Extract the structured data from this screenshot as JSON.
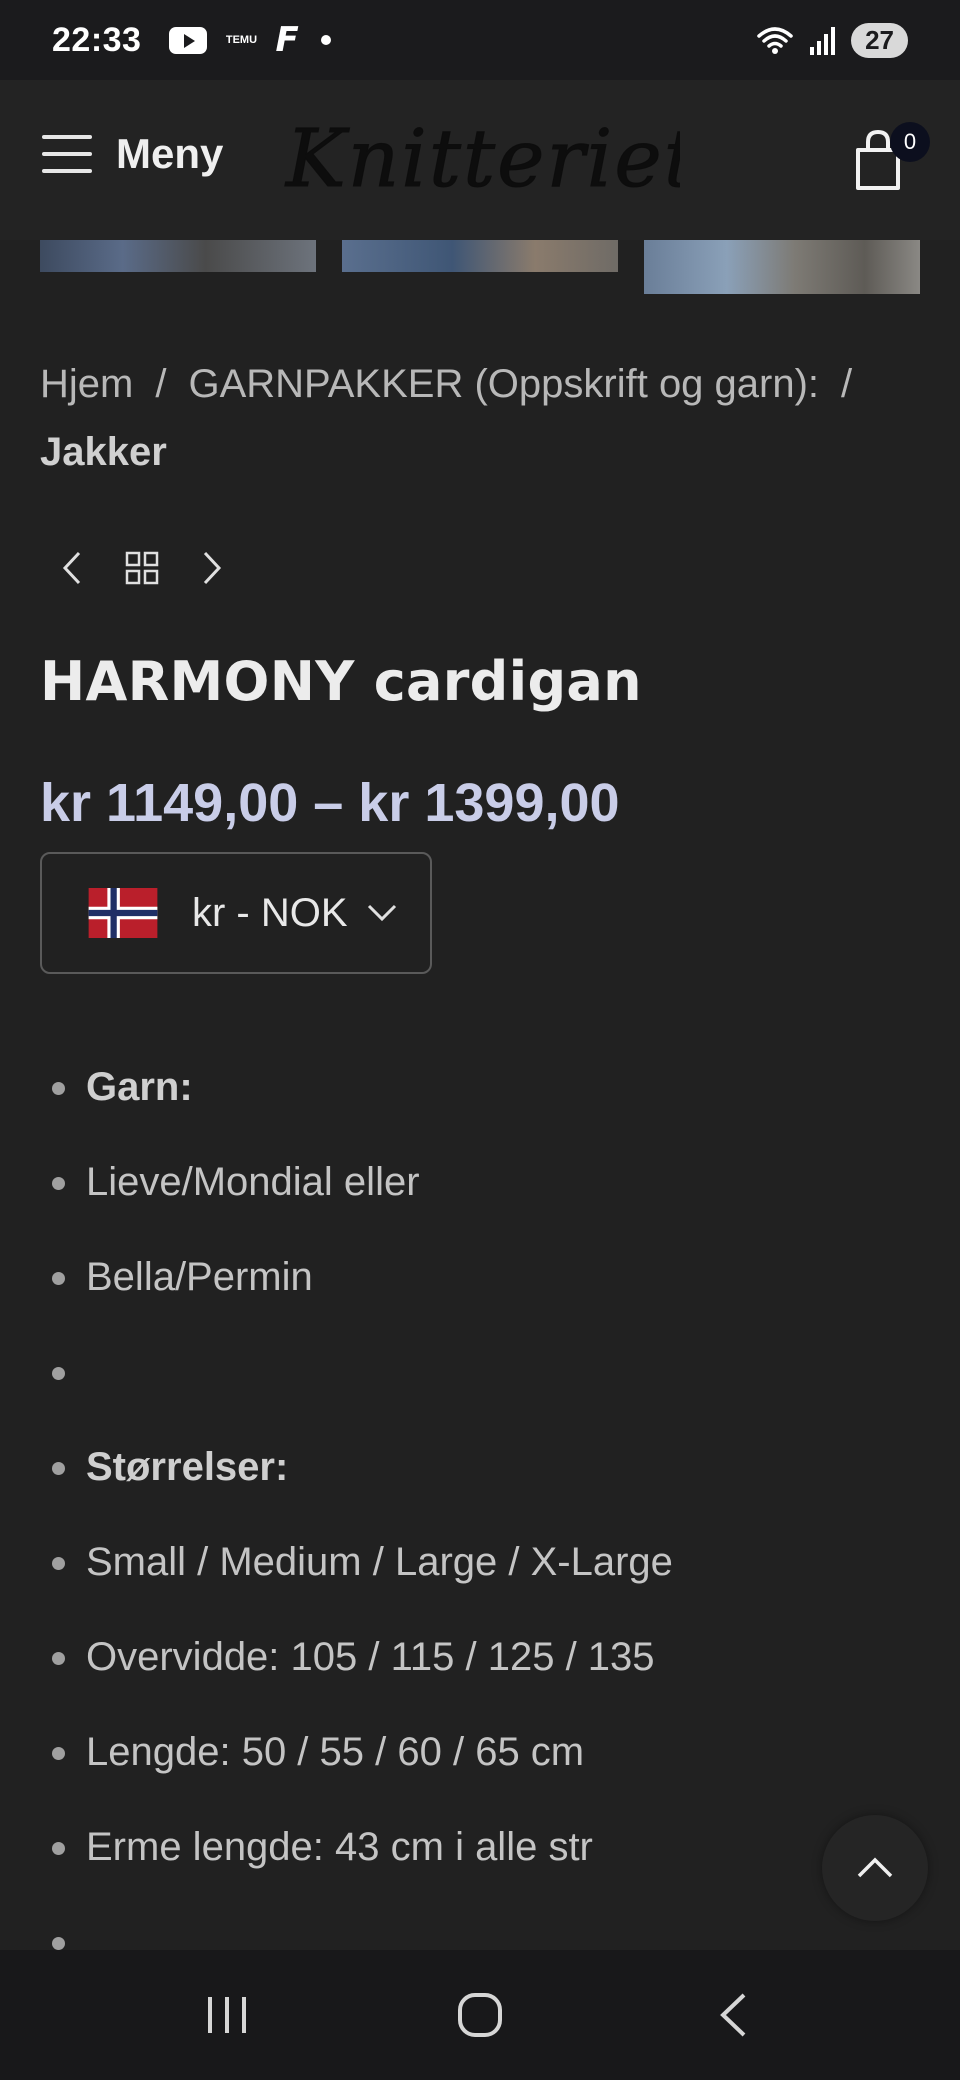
{
  "status_bar": {
    "time": "22:33",
    "temu_label": "TEMU",
    "facebook_label": "F",
    "battery": "27"
  },
  "header": {
    "menu_label": "Meny",
    "logo_text": "Knitteriet",
    "cart_count": "0"
  },
  "breadcrumb": {
    "items": [
      "Hjem",
      "GARNPAKKER (Oppskrift og garn):",
      "Jakker"
    ],
    "separator": "/"
  },
  "product": {
    "title": "HARMONY cardigan",
    "price": "kr 1149,00 – kr 1399,00"
  },
  "currency_selector": {
    "value": "kr - NOK",
    "flag": "norway-flag-icon"
  },
  "details": [
    "Garn:",
    "Lieve/Mondial eller",
    "Bella/Permin",
    "",
    "Størrelser:",
    "Small / Medium /  Large  / X-Large",
    "Overvidde:  105  /  115 /  125 /  135",
    "Lengde:  50 /  55 / 60 /  65  cm",
    "Erme lengde: 43 cm i alle str",
    ""
  ],
  "colors": {
    "background": "#212121",
    "price_accent": "#c9cde8",
    "cart_badge": "#0c0f1e"
  }
}
